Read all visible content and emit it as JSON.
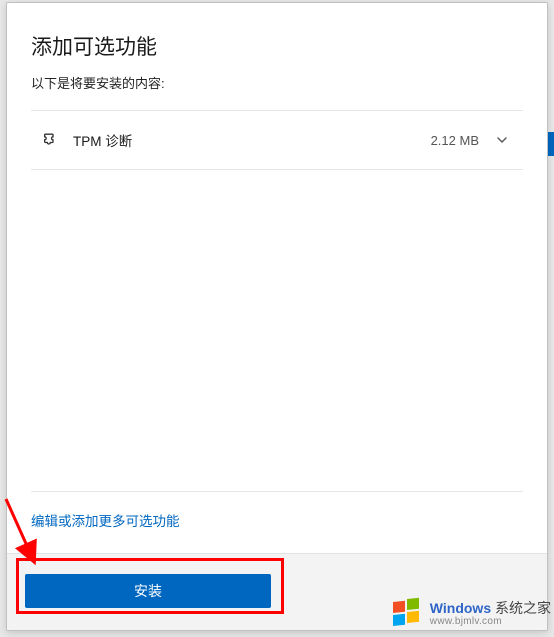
{
  "dialog": {
    "title": "添加可选功能",
    "subtitle": "以下是将要安装的内容:"
  },
  "features": [
    {
      "name": "TPM 诊断",
      "size": "2.12 MB",
      "icon": "puzzle-icon"
    }
  ],
  "link": {
    "edit_more": "编辑或添加更多可选功能"
  },
  "buttons": {
    "install": "安装"
  },
  "watermark": {
    "brand_prefix": "Windows",
    "brand_suffix": " 系统之家",
    "url": "www.bjmlv.com"
  }
}
